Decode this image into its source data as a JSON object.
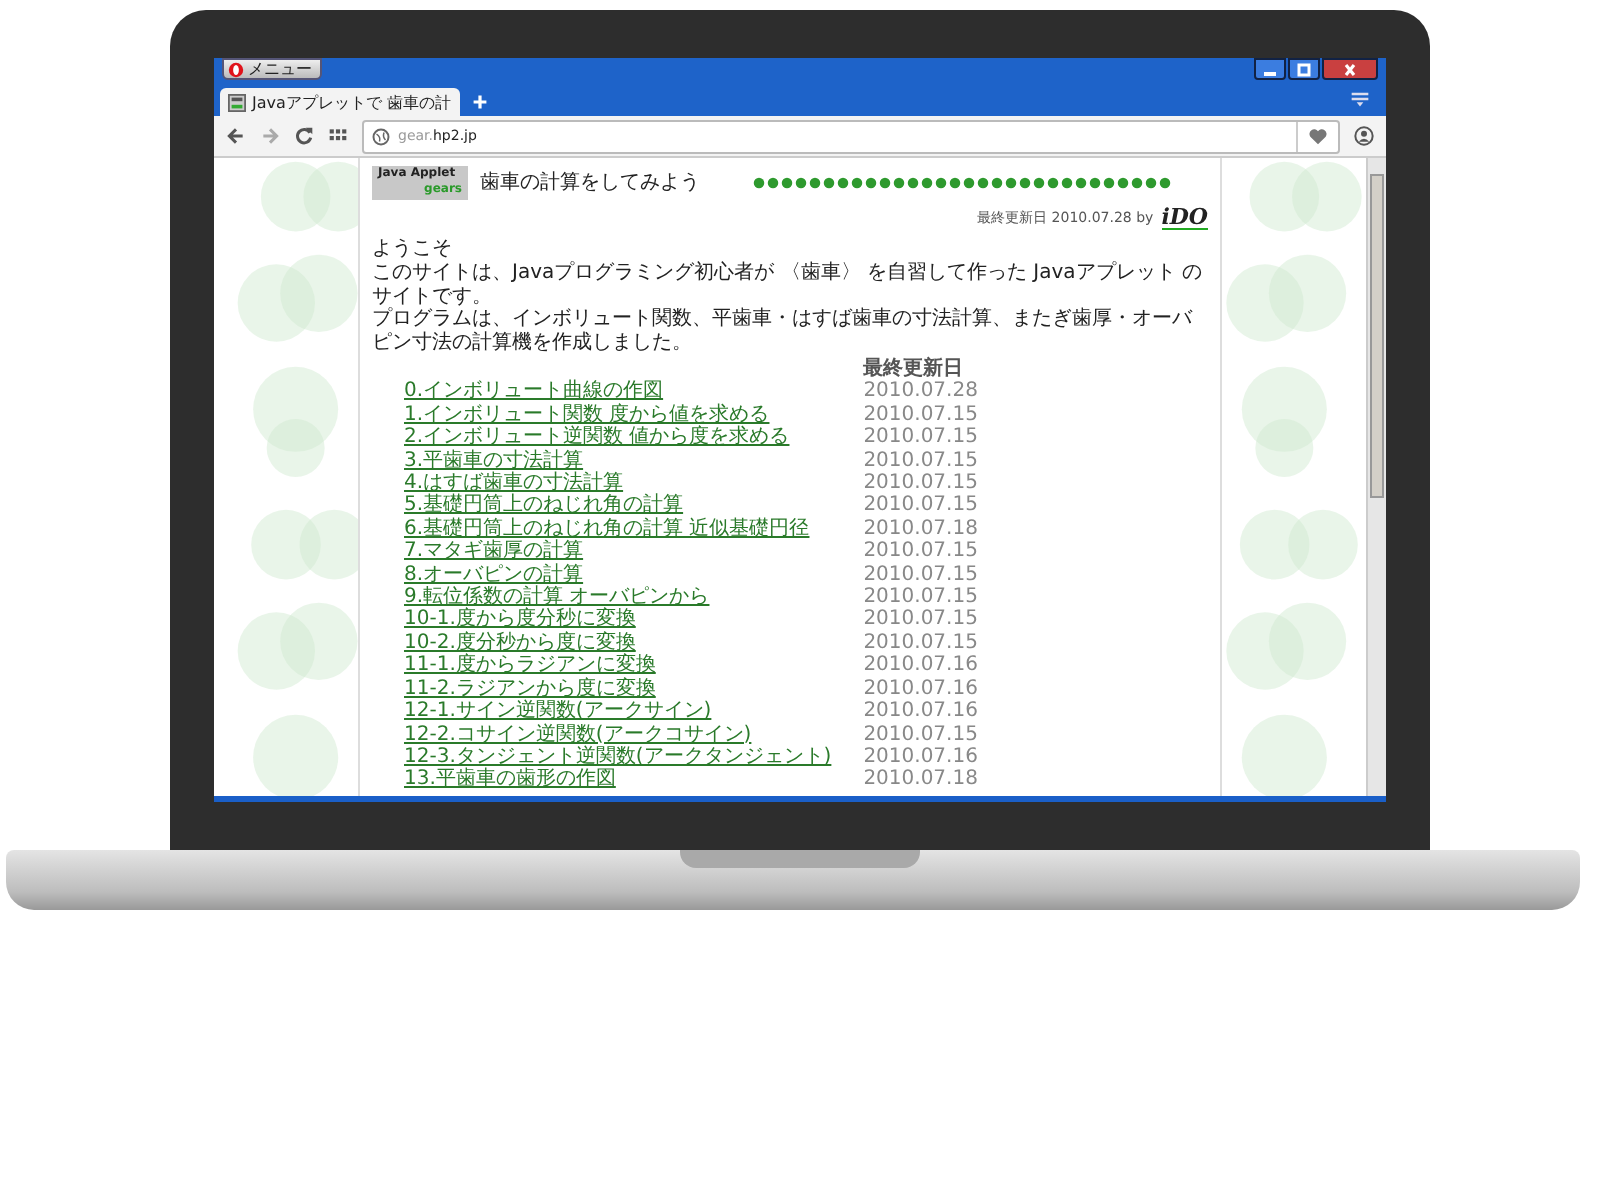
{
  "browser": {
    "menu_label": "メニュー",
    "tab_title": "Javaアプレットで 歯車の計",
    "address": {
      "subdomain": "gear.",
      "domain": "hp2.jp"
    }
  },
  "page": {
    "logo": {
      "line_1": "Java Applet",
      "line_2": "gears"
    },
    "title": "歯車の計算をしてみよう",
    "updated": "最終更新日 2010.07.28 by",
    "author_logo": "iDO",
    "welcome": "ようこそ",
    "paragraphs": [
      "このサイトは、Javaプログラミング初心者が 〈歯車〉 を自習して作った Javaアプレット のサイトです。",
      "プログラムは、インボリュート関数、平歯車・はすば歯車の寸法計算、またぎ歯厚・オーバピン寸法の計算機を作成しました。"
    ],
    "list_heading": "最終更新日",
    "items": [
      {
        "title": "0.インボリュート曲線の作図",
        "date": "2010.07.28"
      },
      {
        "title": "1.インボリュート関数 度から値を求める",
        "date": "2010.07.15"
      },
      {
        "title": "2.インボリュート逆関数 値から度を求める",
        "date": "2010.07.15"
      },
      {
        "title": "3.平歯車の寸法計算",
        "date": "2010.07.15"
      },
      {
        "title": "4.はすば歯車の寸法計算",
        "date": "2010.07.15"
      },
      {
        "title": "5.基礎円筒上のねじれ角の計算",
        "date": "2010.07.15"
      },
      {
        "title": "6.基礎円筒上のねじれ角の計算 近似基礎円径",
        "date": "2010.07.18"
      },
      {
        "title": "7.マタギ歯厚の計算",
        "date": "2010.07.15"
      },
      {
        "title": "8.オーバピンの計算",
        "date": "2010.07.15"
      },
      {
        "title": "9.転位係数の計算 オーバピンから",
        "date": "2010.07.15"
      },
      {
        "title": "10-1.度から度分秒に変換",
        "date": "2010.07.15"
      },
      {
        "title": "10-2.度分秒から度に変換",
        "date": "2010.07.15"
      },
      {
        "title": "11-1.度からラジアンに変換",
        "date": "2010.07.16"
      },
      {
        "title": "11-2.ラジアンから度に変換",
        "date": "2010.07.16"
      },
      {
        "title": "12-1.サイン逆関数(アークサイン)",
        "date": "2010.07.16"
      },
      {
        "title": "12-2.コサイン逆関数(アークコサイン)",
        "date": "2010.07.15"
      },
      {
        "title": "12-3.タンジェント逆関数(アークタンジェント)",
        "date": "2010.07.16"
      },
      {
        "title": "13.平歯車の歯形の作図",
        "date": "2010.07.18"
      }
    ]
  }
}
